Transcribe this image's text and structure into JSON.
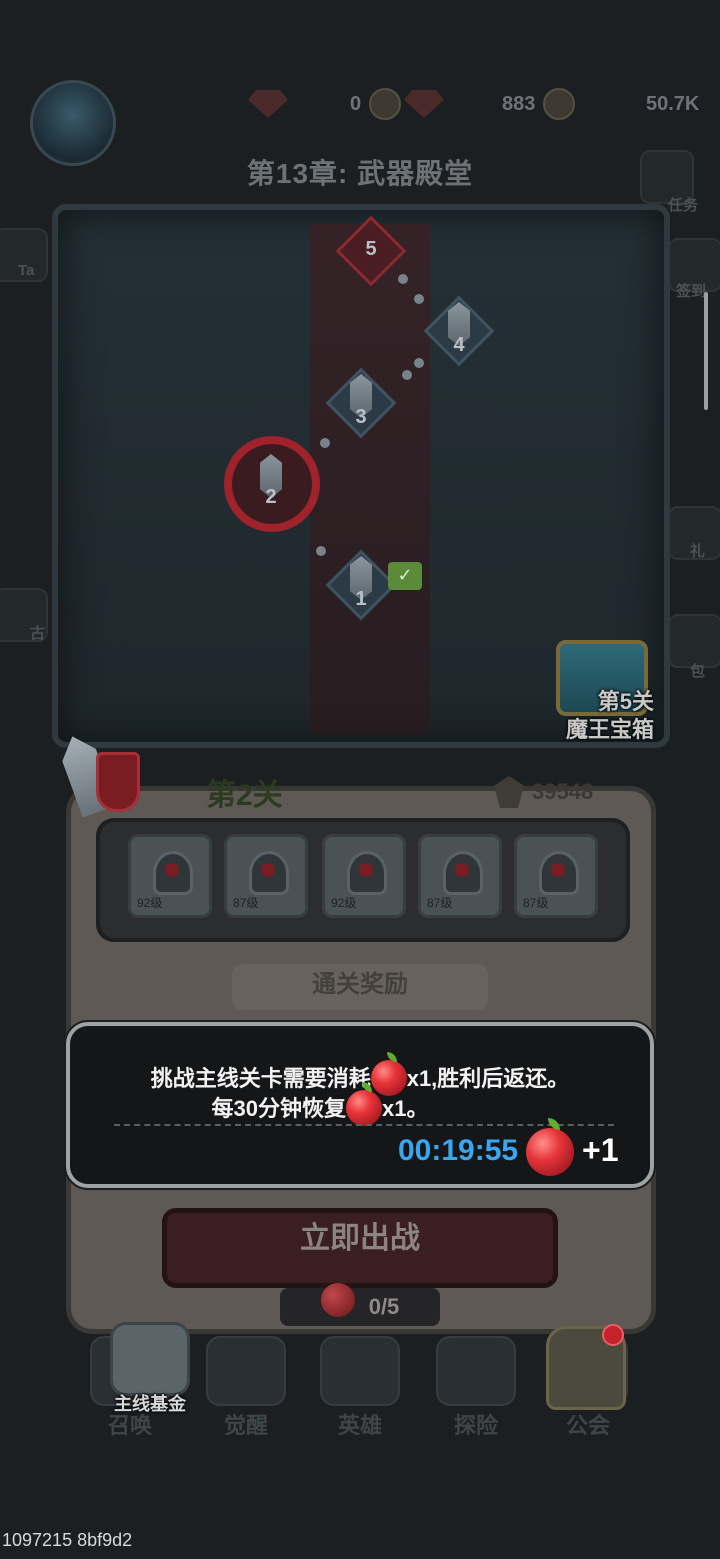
{
  "header": {
    "resources": [
      {
        "name": "diamond",
        "value": "0"
      },
      {
        "name": "ruby",
        "value": "883"
      },
      {
        "name": "gold",
        "value": "50.7K"
      }
    ],
    "chapter_title": "第13章: 武器殿堂"
  },
  "side_left": {
    "labels": [
      "Ta",
      "古"
    ]
  },
  "side_right": {
    "labels": [
      "任务",
      "签到",
      "礼",
      "包"
    ]
  },
  "map": {
    "stages": [
      {
        "num": "5",
        "state": "boss"
      },
      {
        "num": "4",
        "state": "locked"
      },
      {
        "num": "3",
        "state": "locked"
      },
      {
        "num": "2",
        "state": "current"
      },
      {
        "num": "1",
        "state": "cleared"
      }
    ],
    "chest": {
      "line1": "第5关",
      "line2": "魔王宝箱"
    }
  },
  "stage_panel": {
    "stage_name": "第2关",
    "power": "39548",
    "enemies": [
      {
        "level": "92级"
      },
      {
        "level": "87级"
      },
      {
        "level": "92级"
      },
      {
        "level": "87级"
      },
      {
        "level": "87级"
      }
    ],
    "reward_title": "通关奖励",
    "fight_button": "立即出战",
    "stamina": "0/5"
  },
  "tooltip": {
    "line1_pre": "挑战主线关卡需要消耗",
    "line1_post": "x1,胜利后返还。",
    "line2_pre": "每30分钟恢复",
    "line2_post": "x1。",
    "timer": "00:19:55",
    "gain": "+1"
  },
  "bottom_nav": {
    "fund_label": "主线基金",
    "items": [
      "召唤",
      "觉醒",
      "英雄",
      "探险",
      "公会"
    ]
  },
  "build_id": "1097215 8bf9d2",
  "colors": {
    "accent_red": "#a0222a",
    "timer_blue": "#3aa6ee",
    "apple_red": "#e6343a"
  }
}
